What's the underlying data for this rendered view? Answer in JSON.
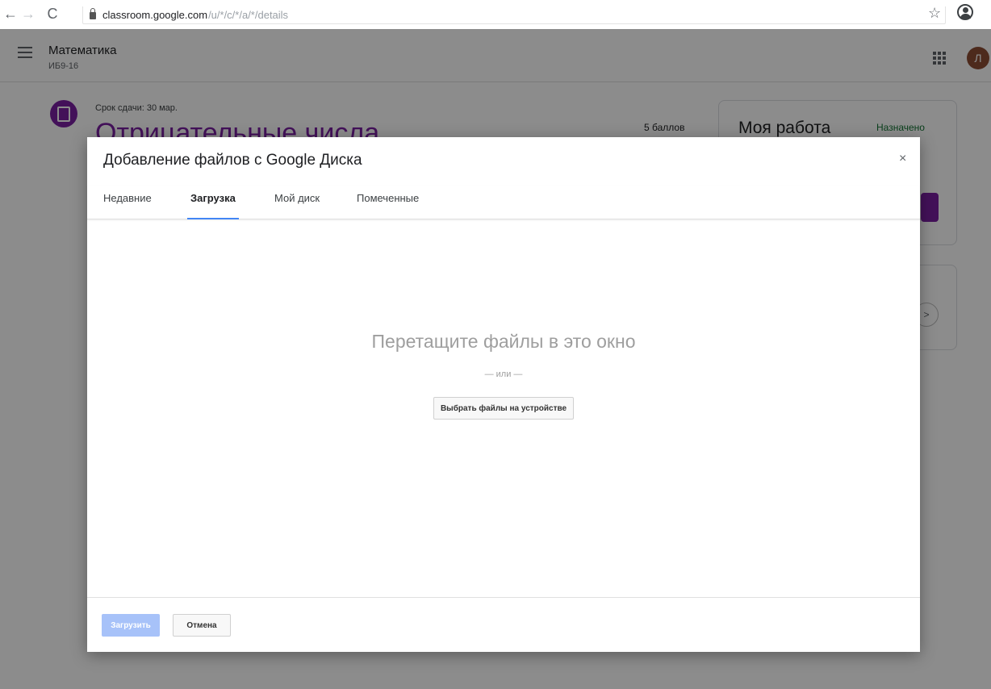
{
  "browser": {
    "url_host": "classroom.google.com",
    "url_path": "/u/*/c/*/a/*/details"
  },
  "app": {
    "class_title": "Математика",
    "class_section": "ИБ9-16",
    "avatar_letter": "Л",
    "due_date": "Срок сдачи: 30 мар.",
    "assignment_title": "Отрицательные числа",
    "points": "5 баллов",
    "my_work_title": "Моя работа",
    "my_work_status": "Назначено"
  },
  "dialog": {
    "title": "Добавление файлов с Google Диска",
    "tabs": [
      "Недавние",
      "Загрузка",
      "Мой диск",
      "Помеченные"
    ],
    "active_tab": "Загрузка",
    "drop_text": "Перетащите файлы в это окно",
    "or_text": "— или —",
    "choose_button": "Выбрать файлы на устройстве",
    "upload_button": "Загрузить",
    "cancel_button": "Отмена"
  },
  "colors": {
    "accent": "#4285f4",
    "classroom_purple": "#7b1fa2",
    "upload_disabled": "#a7c2f9"
  }
}
